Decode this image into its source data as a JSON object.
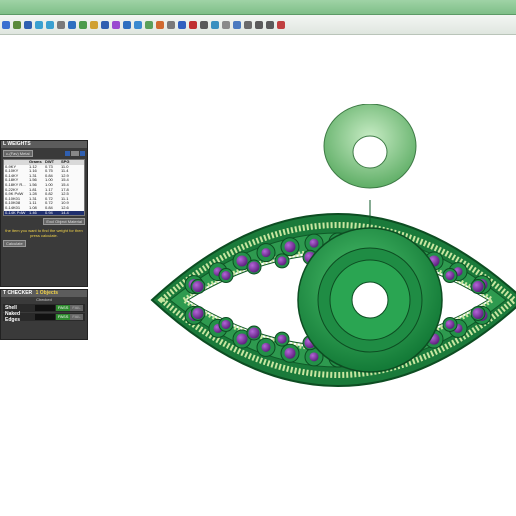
{
  "weights_panel": {
    "title": "L WEIGHTS",
    "dropdown_value": "c-(Fav) Metal",
    "columns": [
      "",
      "Grams",
      "DWT",
      "SPG"
    ],
    "rows": [
      [
        "0-9KY",
        "1.12",
        "0.73",
        "11.0"
      ],
      [
        "0-10KY",
        "1.16",
        "0.75",
        "11.4"
      ],
      [
        "0-14KY",
        "1.31",
        "0.84",
        "12.9"
      ],
      [
        "0-18KY",
        "1.56",
        "1.00",
        "15.4"
      ],
      [
        "0-18KY R...",
        "1.56",
        "1.00",
        "15.4"
      ],
      [
        "0-22KY",
        "1.81",
        "1.17",
        "17.8"
      ],
      [
        "0-9K PdW",
        "1.28",
        "0.82",
        "12.5"
      ],
      [
        "0-10K01",
        "1.31",
        "0.72",
        "11.1"
      ],
      [
        "0-10K08",
        "1.11",
        "0.72",
        "10.9"
      ],
      [
        "0-14K01",
        "1.08",
        "0.84",
        "12.6"
      ],
      [
        "0-14K PdW",
        "1.46",
        "0.94",
        "14.4"
      ]
    ],
    "selected_row": 10,
    "object_button": "Excl Object Material",
    "instruction": "the item you want to find the weight for then press calculate.",
    "calculate_label": "Calculate"
  },
  "checker_panel": {
    "title": "T CHECKER",
    "subtitle_highlight": "1 Objects",
    "subtitle_rest": "Checked",
    "checks": [
      {
        "label": "Shell",
        "pass": "PASS",
        "fail": "FAIL"
      },
      {
        "label": "Naked Edges",
        "pass": "PASS",
        "fail": "FAIL"
      }
    ]
  },
  "colors": {
    "titlebar": "#8cc895",
    "model_green": "#2e9a4f",
    "model_dark": "#0f5a28",
    "bail_light": "#9ed7a0",
    "gem_purple": "#7a2fa0",
    "pass_green": "#2f8a2f"
  },
  "icons": [
    "toolbar-icons"
  ]
}
